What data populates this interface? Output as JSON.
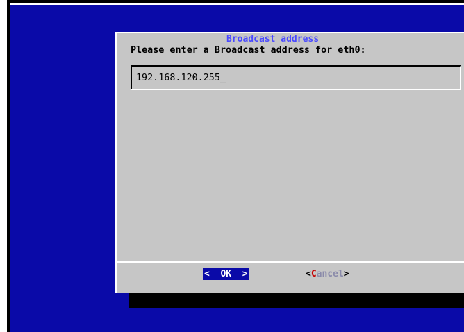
{
  "dialog": {
    "title": "Broadcast address",
    "prompt": "Please enter a Broadcast address for eth0:",
    "input_value": "192.168.120.255_"
  },
  "buttons": {
    "ok": {
      "left": "<",
      "label": "OK",
      "right": ">"
    },
    "cancel": {
      "left": "<",
      "hotkey": "C",
      "rest": "ancel",
      "right": ">"
    }
  },
  "colors": {
    "screen_background": "#0a0aa8",
    "dialog_background": "#c6c6c6",
    "title_text": "#4a4aff",
    "selected_button": "#0a0aa8",
    "hotkey": "#c40000"
  }
}
